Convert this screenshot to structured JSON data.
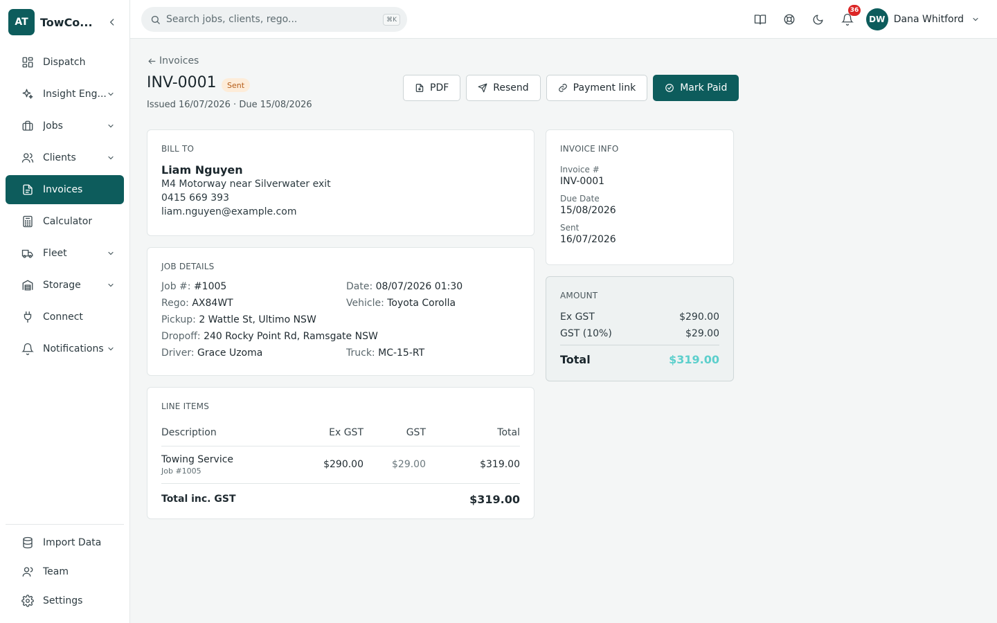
{
  "brand": {
    "initials": "AT",
    "name": "TowCo..."
  },
  "sidebar": {
    "items": [
      {
        "label": "Dispatch",
        "icon": "dashboard-icon",
        "has_children": false
      },
      {
        "label": "Insight Eng...",
        "icon": "sparkle-icon",
        "has_children": true
      },
      {
        "label": "Jobs",
        "icon": "briefcase-icon",
        "has_children": true
      },
      {
        "label": "Clients",
        "icon": "users-icon",
        "has_children": true
      },
      {
        "label": "Invoices",
        "icon": "file-icon",
        "has_children": false,
        "active": true
      },
      {
        "label": "Calculator",
        "icon": "calculator-icon",
        "has_children": false
      },
      {
        "label": "Fleet",
        "icon": "truck-icon",
        "has_children": true
      },
      {
        "label": "Storage",
        "icon": "warehouse-icon",
        "has_children": true
      },
      {
        "label": "Connect",
        "icon": "plug-icon",
        "has_children": false
      },
      {
        "label": "Notifications",
        "icon": "bell-icon",
        "has_children": true
      }
    ],
    "bottom_items": [
      {
        "label": "Import Data",
        "icon": "database-icon"
      },
      {
        "label": "Team",
        "icon": "user-icon"
      },
      {
        "label": "Settings",
        "icon": "gear-icon"
      }
    ]
  },
  "topbar": {
    "search_placeholder": "Search jobs, clients, rego...",
    "search_shortcut": "⌘K",
    "notification_count": "36",
    "user": {
      "initials": "DW",
      "name": "Dana Whitford"
    }
  },
  "invoice": {
    "back_label": "Invoices",
    "number": "INV-0001",
    "status": "Sent",
    "issued_line": "Issued 16/07/2026 · Due 15/08/2026",
    "actions": {
      "pdf": "PDF",
      "resend": "Resend",
      "payment_link": "Payment link",
      "mark_paid": "Mark Paid"
    }
  },
  "bill_to": {
    "label": "BILL TO",
    "name": "Liam Nguyen",
    "address": "M4 Motorway near Silverwater exit",
    "phone": "0415 669 393",
    "email": "liam.nguyen@example.com"
  },
  "job_details": {
    "label": "JOB DETAILS",
    "job_no": {
      "k": "Job #:",
      "v": "#1005"
    },
    "date": {
      "k": "Date:",
      "v": "08/07/2026 01:30"
    },
    "rego": {
      "k": "Rego:",
      "v": "AX84WT"
    },
    "vehicle": {
      "k": "Vehicle:",
      "v": "Toyota Corolla"
    },
    "pickup": {
      "k": "Pickup:",
      "v": "2 Wattle St, Ultimo NSW"
    },
    "dropoff": {
      "k": "Dropoff:",
      "v": "240 Rocky Point Rd, Ramsgate NSW"
    },
    "driver": {
      "k": "Driver:",
      "v": "Grace Uzoma"
    },
    "truck": {
      "k": "Truck:",
      "v": "MC-15-RT"
    }
  },
  "line_items": {
    "label": "LINE ITEMS",
    "headers": {
      "desc": "Description",
      "ex": "Ex GST",
      "gst": "GST",
      "total": "Total"
    },
    "rows": [
      {
        "desc": "Towing Service",
        "sub": "Job #1005",
        "ex": "$290.00",
        "gst": "$29.00",
        "total": "$319.00"
      }
    ],
    "total_label": "Total inc. GST",
    "total_value": "$319.00"
  },
  "invoice_info": {
    "label": "INVOICE INFO",
    "invoice_no_label": "Invoice #",
    "invoice_no": "INV-0001",
    "due_label": "Due Date",
    "due": "15/08/2026",
    "sent_label": "Sent",
    "sent": "16/07/2026"
  },
  "amount": {
    "label": "AMOUNT",
    "ex_label": "Ex GST",
    "ex": "$290.00",
    "gst_label": "GST (10%)",
    "gst": "$29.00",
    "total_label": "Total",
    "total": "$319.00"
  },
  "colors": {
    "brand": "#0d5c5c",
    "status_sent_bg": "#fdecd9",
    "status_sent_fg": "#b45c18",
    "total_accent": "#5ccfcc",
    "badge": "#dc2626"
  }
}
